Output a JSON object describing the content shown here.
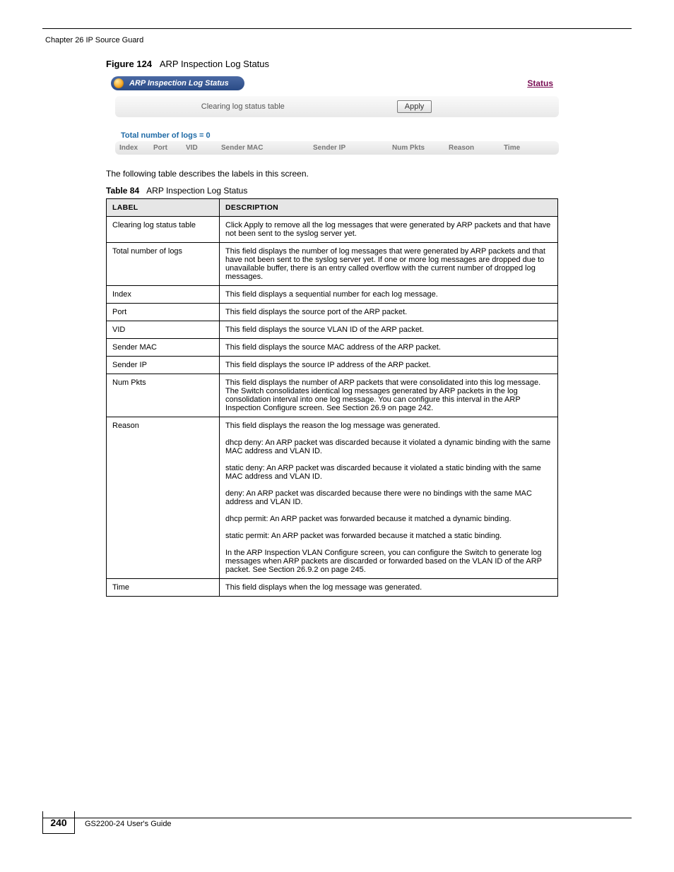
{
  "header": {
    "chapter_left": "Chapter 26 IP Source Guard",
    "chapter_right": ""
  },
  "figure": {
    "number": "Figure 124",
    "title": "ARP Inspection Log Status"
  },
  "screenshot": {
    "title": "ARP Inspection Log Status",
    "status_link": "Status",
    "clearing_label": "Clearing log status table",
    "apply_label": "Apply",
    "total_logs_label": "Total number of logs = 0",
    "columns": [
      "Index",
      "Port",
      "VID",
      "Sender MAC",
      "Sender IP",
      "Num Pkts",
      "Reason",
      "Time"
    ]
  },
  "intro_text": "The following table describes the labels in this screen.",
  "table_caption": {
    "number": "Table 84",
    "title": "ARP Inspection Log Status"
  },
  "table": {
    "headers": [
      "LABEL",
      "DESCRIPTION"
    ],
    "rows": [
      {
        "label": "Clearing log status table",
        "desc": "Click Apply to remove all the log messages that were generated by ARP packets and that have not been sent to the syslog server yet."
      },
      {
        "label": "Total number of logs",
        "desc": "This field displays the number of log messages that were generated by ARP packets and that have not been sent to the syslog server yet. If one or more log messages are dropped due to unavailable buffer, there is an entry called overflow with the current number of dropped log messages."
      },
      {
        "label": "Index",
        "desc": "This field displays a sequential number for each log message."
      },
      {
        "label": "Port",
        "desc": "This field displays the source port of the ARP packet."
      },
      {
        "label": "VID",
        "desc": "This field displays the source VLAN ID of the ARP packet."
      },
      {
        "label": "Sender MAC",
        "desc": "This field displays the source MAC address of the ARP packet."
      },
      {
        "label": "Sender IP",
        "desc": "This field displays the source IP address of the ARP packet."
      },
      {
        "label": "Num Pkts",
        "desc": "This field displays the number of ARP packets that were consolidated into this log message. The Switch consolidates identical log messages generated by ARP packets in the log consolidation interval into one log message. You can configure this interval in the ARP Inspection Configure screen. See Section 26.9 on page 242."
      },
      {
        "label": "Reason",
        "desc": "This field displays the reason the log message was generated.\n\ndhcp deny: An ARP packet was discarded because it violated a dynamic binding with the same MAC address and VLAN ID.\n\nstatic deny: An ARP packet was discarded because it violated a static binding with the same MAC address and VLAN ID.\n\ndeny: An ARP packet was discarded because there were no bindings with the same MAC address and VLAN ID.\n\ndhcp permit: An ARP packet was forwarded because it matched a dynamic binding.\n\nstatic permit: An ARP packet was forwarded because it matched a static binding.\n\nIn the ARP Inspection VLAN Configure screen, you can configure the Switch to generate log messages when ARP packets are discarded or forwarded based on the VLAN ID of the ARP packet. See Section 26.9.2 on page 245."
      },
      {
        "label": "Time",
        "desc": "This field displays when the log message was generated."
      }
    ]
  },
  "footer": {
    "page_number": "240",
    "guide": "GS2200-24 User's Guide"
  }
}
